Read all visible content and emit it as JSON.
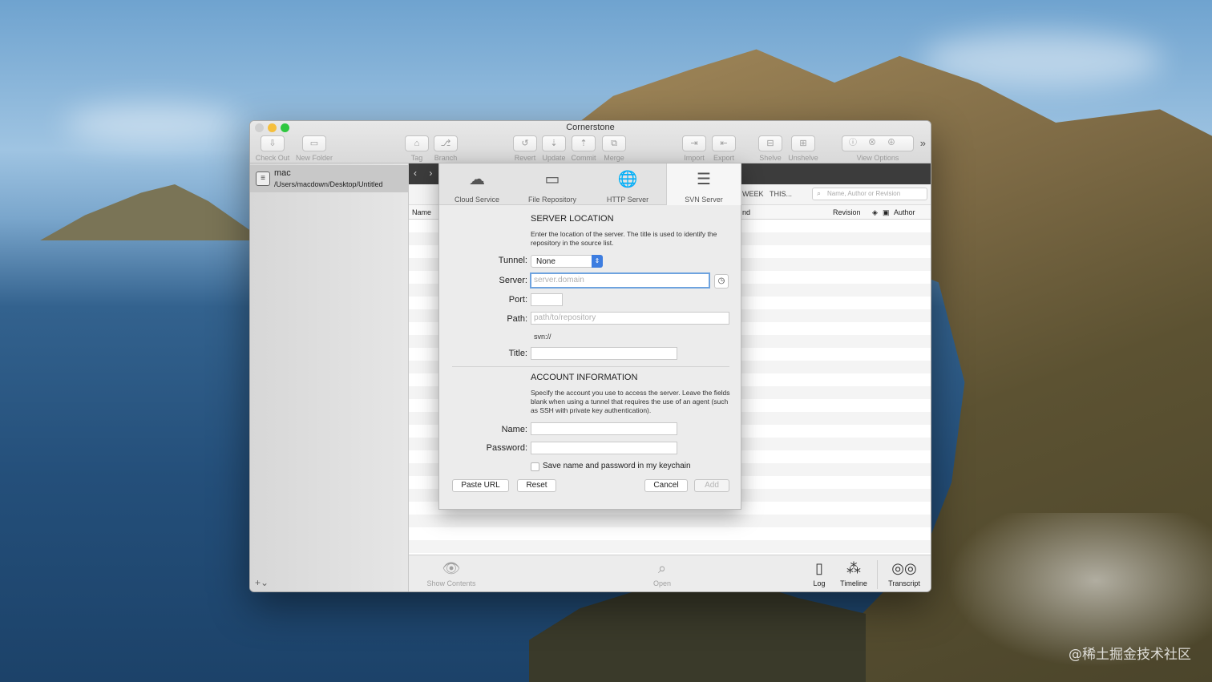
{
  "window": {
    "title": "Cornerstone"
  },
  "toolbar": {
    "items": [
      {
        "label": "Check Out",
        "glyph": "⇩"
      },
      {
        "label": "New Folder",
        "glyph": "▭"
      },
      {
        "label": "Tag",
        "glyph": "⌂"
      },
      {
        "label": "Branch",
        "glyph": "⎇"
      },
      {
        "label": "Revert",
        "glyph": "↺"
      },
      {
        "label": "Update",
        "glyph": "⇣"
      },
      {
        "label": "Commit",
        "glyph": "⇡"
      },
      {
        "label": "Merge",
        "glyph": "⧉"
      },
      {
        "label": "Import",
        "glyph": "⇥"
      },
      {
        "label": "Export",
        "glyph": "⇤"
      },
      {
        "label": "Shelve",
        "glyph": "⊟"
      },
      {
        "label": "Unshelve",
        "glyph": "⊞"
      }
    ],
    "view_options_label": "View Options",
    "view_options_glyphs": [
      "ⓘ",
      "⊗",
      "⊕"
    ],
    "more_glyph": "»"
  },
  "sidebar": {
    "repo": {
      "name": "mac",
      "path": "/Users/macdown/Desktop/Untitled"
    },
    "add_glyph": "+⌄"
  },
  "main": {
    "nav_glyph": "‹ ›",
    "filters": {
      "week": "WEEK",
      "this": "THIS..."
    },
    "search_placeholder": "Name, Author or Revision",
    "columns": {
      "name": "Name",
      "partial": "nd",
      "revision": "Revision",
      "author": "Author"
    }
  },
  "bottombar": {
    "show_contents": "Show Contents",
    "open": "Open",
    "log": "Log",
    "timeline": "Timeline",
    "transcript": "Transcript"
  },
  "dialog": {
    "tabs": [
      {
        "label": "Cloud Service",
        "glyph": "☁"
      },
      {
        "label": "File Repository",
        "glyph": "▭"
      },
      {
        "label": "HTTP Server",
        "glyph": "🌐"
      },
      {
        "label": "SVN Server",
        "glyph": "☰"
      }
    ],
    "active_tab": "SVN Server",
    "server_location": {
      "title": "SERVER LOCATION",
      "description": "Enter the location of the server. The title is used to identify the repository in the source list.",
      "tunnel_label": "Tunnel:",
      "tunnel_value": "None",
      "server_label": "Server:",
      "server_placeholder": "server.domain",
      "port_label": "Port:",
      "port_value": "",
      "path_label": "Path:",
      "path_placeholder": "path/to/repository",
      "svn_prefix": "svn://",
      "title_label": "Title:",
      "title_value": ""
    },
    "account": {
      "title": "ACCOUNT INFORMATION",
      "description": "Specify the account you use to access the server. Leave the fields blank when using a tunnel that requires the use of an agent (such as SSH with private key authentication).",
      "name_label": "Name:",
      "name_value": "",
      "password_label": "Password:",
      "password_value": "",
      "keychain_label": "Save name and password in my keychain",
      "keychain_checked": false
    },
    "buttons": {
      "paste_url": "Paste URL",
      "reset": "Reset",
      "cancel": "Cancel",
      "add": "Add"
    }
  },
  "watermark": "@稀土掘金技术社区",
  "colors": {
    "accent": "#3d7de0",
    "focus_ring": "#6ea3df",
    "dark_bar": "#3c3c3c"
  }
}
